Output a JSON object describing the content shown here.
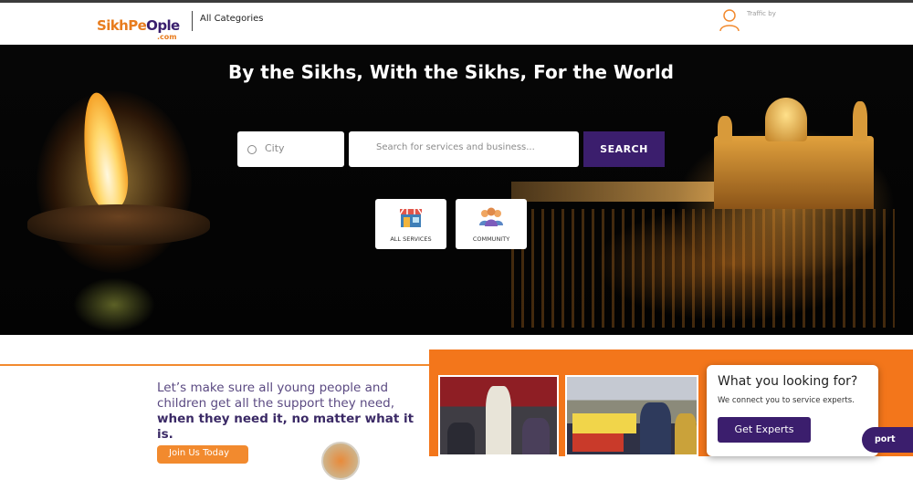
{
  "header": {
    "logo": {
      "part1": "SikhPe",
      "part2": "O",
      "part3": "ple",
      "domain": ".com"
    },
    "all_categories": "All Categories",
    "traffic_label": "Traffic by"
  },
  "hero": {
    "title": "By the Sikhs, With the Sikhs, For the World",
    "city_placeholder": "City",
    "search_placeholder": "Search for services and business...",
    "search_button": "SEARCH",
    "tiles": [
      {
        "label": "ALL SERVICES",
        "icon": "shop-icon"
      },
      {
        "label": "COMMUNITY",
        "icon": "community-icon"
      }
    ]
  },
  "promo": {
    "line1": "Let’s make sure all young people and",
    "line2": "children get all the support they need,",
    "line3": "when they need it, no matter what it is.",
    "join_button": "Join Us Today"
  },
  "popup": {
    "question": "What you looking for?",
    "subtitle": "We connect you to service experts.",
    "button": "Get Experts"
  },
  "support_button": "port",
  "colors": {
    "brand_purple": "#3b1e6d",
    "brand_orange": "#f3761b"
  }
}
